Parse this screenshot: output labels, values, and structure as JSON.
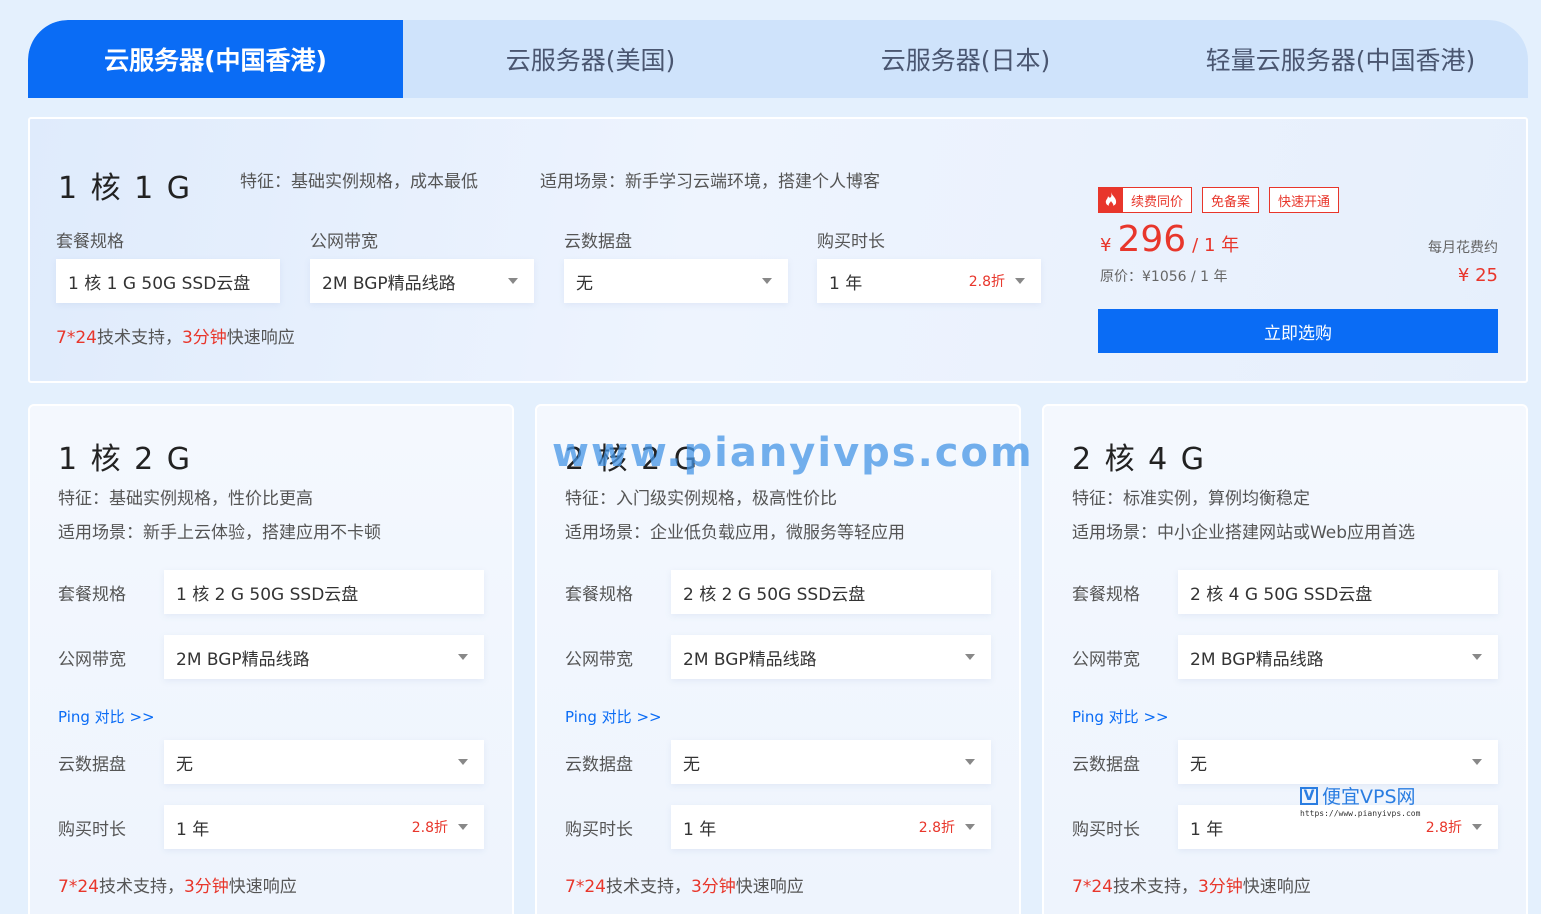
{
  "tabs": [
    {
      "label": "云服务器(中国香港)",
      "active": true
    },
    {
      "label": "云服务器(美国)",
      "active": false
    },
    {
      "label": "云服务器(日本)",
      "active": false
    },
    {
      "label": "轻量云服务器(中国香港)",
      "active": false
    }
  ],
  "hero": {
    "title": "1 核 1 G",
    "feature": "特征：基础实例规格，成本最低",
    "scene": "适用场景：新手学习云端环境，搭建个人博客",
    "fields": {
      "spec_label": "套餐规格",
      "spec_value": "1 核 1 G   50G SSD云盘",
      "bandwidth_label": "公网带宽",
      "bandwidth_value": "2M BGP精品线路",
      "disk_label": "云数据盘",
      "disk_value": "无",
      "duration_label": "购买时长",
      "duration_value": "1 年",
      "duration_discount": "2.8折"
    },
    "support_red1": "7*24",
    "support_mid": "技术支持，",
    "support_red2": "3分钟",
    "support_end": "快速响应",
    "badges": {
      "hot": "续费同价",
      "b2": "免备案",
      "b3": "快速开通"
    },
    "price": {
      "yen": "¥",
      "amount": "296",
      "per": "/ 1 年",
      "original": "原价：¥1056 / 1 年"
    },
    "monthly": {
      "label": "每月花费约",
      "value": "¥ 25"
    },
    "buy_label": "立即选购"
  },
  "cards": [
    {
      "title": "1 核 2 G",
      "feature": "特征：基础实例规格，性价比更高",
      "scene": "适用场景：新手上云体验，搭建应用不卡顿",
      "spec_label": "套餐规格",
      "spec_value": "1 核 2 G   50G SSD云盘",
      "bandwidth_label": "公网带宽",
      "bandwidth_value": "2M BGP精品线路",
      "ping": "Ping 对比 >>",
      "disk_label": "云数据盘",
      "disk_value": "无",
      "duration_label": "购买时长",
      "duration_value": "1 年",
      "duration_discount": "2.8折"
    },
    {
      "title": "2 核 2 G",
      "feature": "特征：入门级实例规格，极高性价比",
      "scene": "适用场景：企业低负载应用，微服务等轻应用",
      "spec_label": "套餐规格",
      "spec_value": "2 核 2 G   50G SSD云盘",
      "bandwidth_label": "公网带宽",
      "bandwidth_value": "2M BGP精品线路",
      "ping": "Ping 对比 >>",
      "disk_label": "云数据盘",
      "disk_value": "无",
      "duration_label": "购买时长",
      "duration_value": "1 年",
      "duration_discount": "2.8折"
    },
    {
      "title": "2 核 4 G",
      "feature": "特征：标准实例，算例均衡稳定",
      "scene": "适用场景：中小企业搭建网站或Web应用首选",
      "spec_label": "套餐规格",
      "spec_value": "2 核 4 G   50G SSD云盘",
      "bandwidth_label": "公网带宽",
      "bandwidth_value": "2M BGP精品线路",
      "ping": "Ping 对比 >>",
      "disk_label": "云数据盘",
      "disk_value": "无",
      "duration_label": "购买时长",
      "duration_value": "1 年",
      "duration_discount": "2.8折"
    }
  ],
  "watermark": {
    "big": "www.pianyivps.com",
    "small_name": "便宜VPS网",
    "small_url": "https://www.pianyivps.com",
    "v": "V"
  },
  "colors": {
    "accent": "#0a6cf5",
    "red": "#e8362b",
    "bg": "#e4f0fd"
  }
}
